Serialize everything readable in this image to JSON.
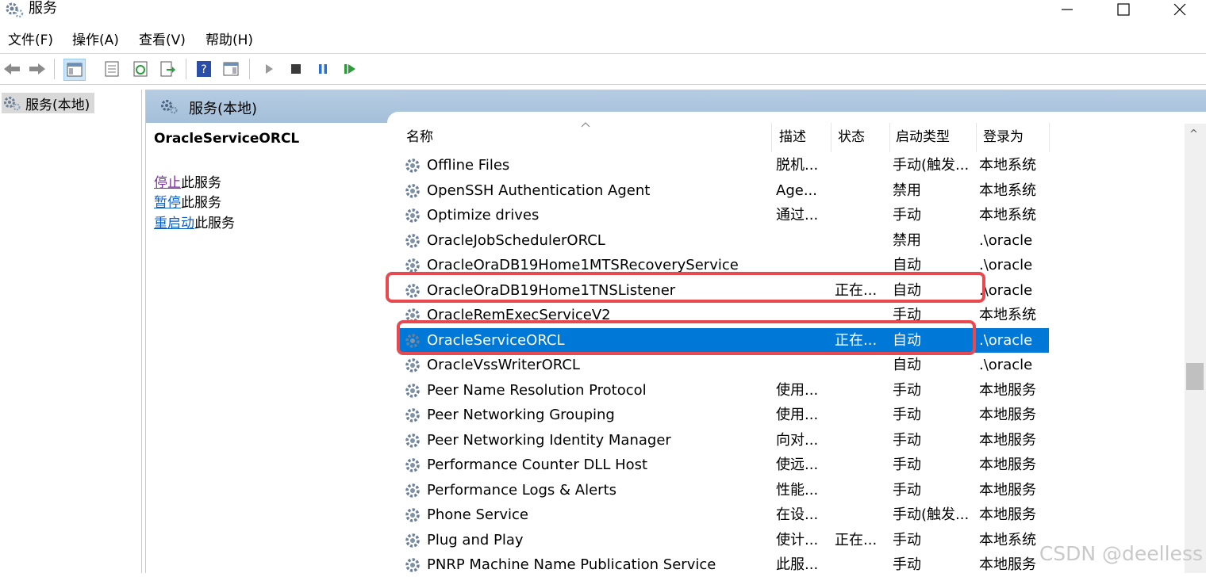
{
  "window": {
    "title": "服务"
  },
  "menu": [
    "文件(F)",
    "操作(A)",
    "查看(V)",
    "帮助(H)"
  ],
  "tree": {
    "root_label": "服务(本地)"
  },
  "panel": {
    "title": "服务(本地)"
  },
  "detail": {
    "service_name": "OracleServiceORCL",
    "stop_link": "停止",
    "stop_suffix": "此服务",
    "pause_link": "暂停",
    "pause_suffix": "此服务",
    "restart_link": "重启动",
    "restart_suffix": "此服务"
  },
  "columns": {
    "name": "名称",
    "desc": "描述",
    "status": "状态",
    "startup": "启动类型",
    "logon": "登录为"
  },
  "rows": [
    {
      "name": "Offline Files",
      "desc": "脱机...",
      "status": "",
      "startup": "手动(触发...",
      "logon": "本地系统"
    },
    {
      "name": "OpenSSH Authentication Agent",
      "desc": "Age...",
      "status": "",
      "startup": "禁用",
      "logon": "本地系统"
    },
    {
      "name": "Optimize drives",
      "desc": "通过...",
      "status": "",
      "startup": "手动",
      "logon": "本地系统"
    },
    {
      "name": "OracleJobSchedulerORCL",
      "desc": "",
      "status": "",
      "startup": "禁用",
      "logon": ".\\oracle"
    },
    {
      "name": "OracleOraDB19Home1MTSRecoveryService",
      "desc": "",
      "status": "",
      "startup": "自动",
      "logon": ".\\oracle"
    },
    {
      "name": "OracleOraDB19Home1TNSListener",
      "desc": "",
      "status": "正在...",
      "startup": "自动",
      "logon": ".\\oracle"
    },
    {
      "name": "OracleRemExecServiceV2",
      "desc": "",
      "status": "",
      "startup": "手动",
      "logon": "本地系统"
    },
    {
      "name": "OracleServiceORCL",
      "desc": "",
      "status": "正在...",
      "startup": "自动",
      "logon": ".\\oracle"
    },
    {
      "name": "OracleVssWriterORCL",
      "desc": "",
      "status": "",
      "startup": "自动",
      "logon": ".\\oracle"
    },
    {
      "name": "Peer Name Resolution Protocol",
      "desc": "使用...",
      "status": "",
      "startup": "手动",
      "logon": "本地服务"
    },
    {
      "name": "Peer Networking Grouping",
      "desc": "使用...",
      "status": "",
      "startup": "手动",
      "logon": "本地服务"
    },
    {
      "name": "Peer Networking Identity Manager",
      "desc": "向对...",
      "status": "",
      "startup": "手动",
      "logon": "本地服务"
    },
    {
      "name": "Performance Counter DLL Host",
      "desc": "使远...",
      "status": "",
      "startup": "手动",
      "logon": "本地服务"
    },
    {
      "name": "Performance Logs & Alerts",
      "desc": "性能...",
      "status": "",
      "startup": "手动",
      "logon": "本地服务"
    },
    {
      "name": "Phone Service",
      "desc": "在设...",
      "status": "",
      "startup": "手动(触发...",
      "logon": "本地服务"
    },
    {
      "name": "Plug and Play",
      "desc": "使计...",
      "status": "正在...",
      "startup": "手动",
      "logon": "本地系统"
    },
    {
      "name": "PNRP Machine Name Publication Service",
      "desc": "此服...",
      "status": "",
      "startup": "手动",
      "logon": "本地服务"
    }
  ],
  "selected_row": "OracleServiceORCL",
  "watermark": "CSDN @deelless",
  "colors": {
    "selection": "#0078d7",
    "highlight_box": "#e8484f",
    "header_band": "#a9c3dc"
  }
}
